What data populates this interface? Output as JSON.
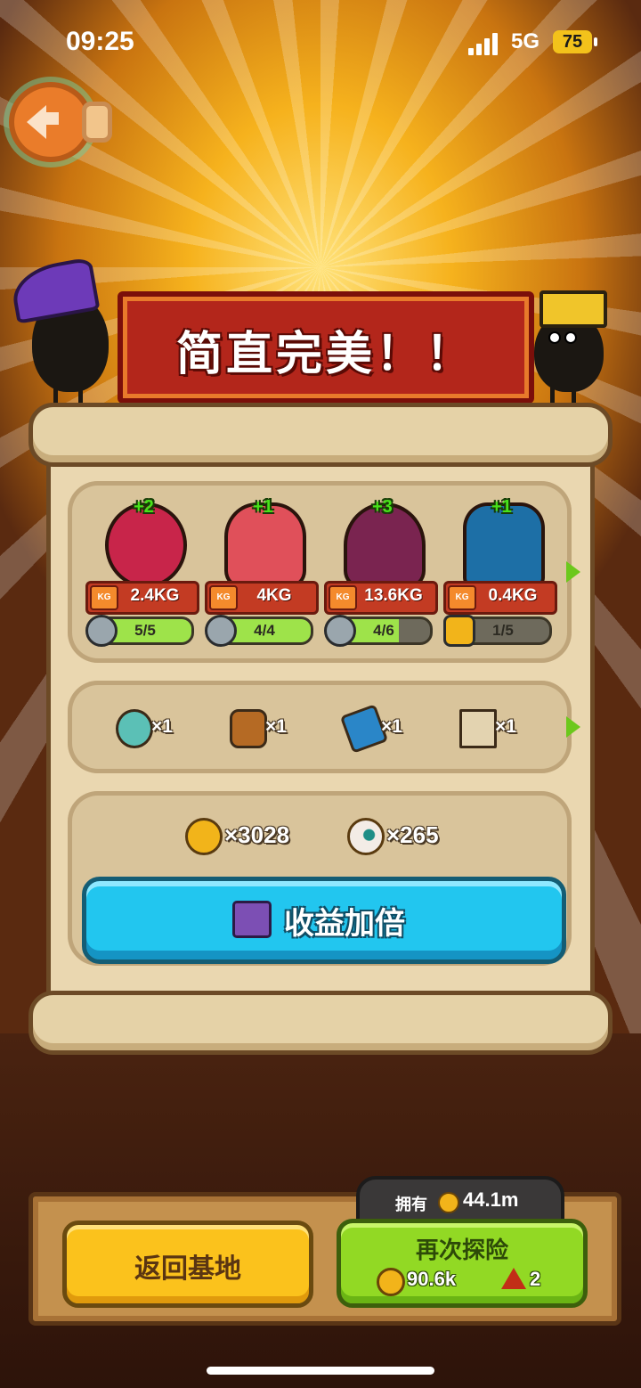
{
  "status_bar": {
    "time": "09:25",
    "network": "5G",
    "battery": "75"
  },
  "banner": {
    "title": "简直完美！！"
  },
  "monsters": [
    {
      "plus": "+2",
      "weight": "2.4KG",
      "progress_text": "5/5",
      "progress": 1.0,
      "color": "#c8254a"
    },
    {
      "plus": "+1",
      "weight": "4KG",
      "progress_text": "4/4",
      "progress": 1.0,
      "color": "#e0505a"
    },
    {
      "plus": "+3",
      "weight": "13.6KG",
      "progress_text": "4/6",
      "progress": 0.667,
      "color": "#7a2450"
    },
    {
      "plus": "+1",
      "weight": "0.4KG",
      "progress_text": "1/5",
      "progress": 0.2,
      "color": "#1d6fa6"
    }
  ],
  "kg_tag": "KG",
  "items": [
    {
      "icon": "egg-icon",
      "count": "×1",
      "color": "#5bc0b6"
    },
    {
      "icon": "helmet-icon",
      "count": "×1",
      "color": "#b56a24"
    },
    {
      "icon": "device-icon",
      "count": "×1",
      "color": "#2a86c8"
    },
    {
      "icon": "map-scroll-icon",
      "count": "×1",
      "color": "#d9c49b"
    }
  ],
  "rewards": [
    {
      "icon": "gold-coin-icon",
      "count": "×3028",
      "color": "#f2b41a"
    },
    {
      "icon": "eyeball-icon",
      "count": "×265",
      "color": "#f3ece6"
    }
  ],
  "double_button": {
    "label": "收益加倍"
  },
  "owned": {
    "label": "拥有",
    "value": "44.1m"
  },
  "home_button": {
    "label": "返回基地"
  },
  "again_button": {
    "label": "再次探险",
    "coin_cost": "90.6k",
    "ticket_cost": "2"
  },
  "colors": {
    "accent_blue": "#22c6ef",
    "accent_green": "#92d924",
    "accent_yellow": "#fbc21c",
    "banner_red": "#b3261b"
  }
}
